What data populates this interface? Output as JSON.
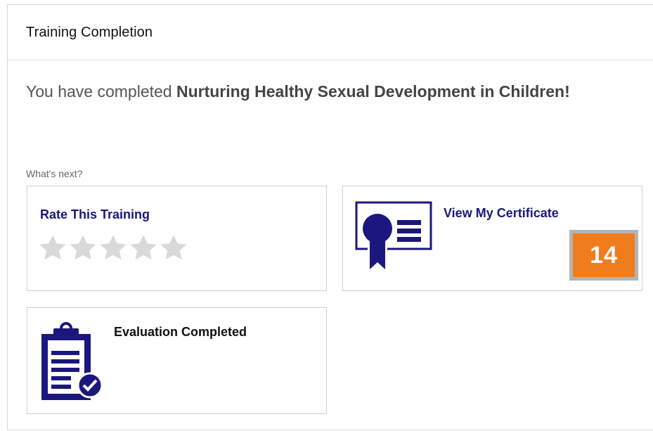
{
  "header": {
    "title": "Training Completion"
  },
  "completion": {
    "prefix": "You have completed ",
    "course_name": "Nurturing Healthy Sexual Development in Children!"
  },
  "next": {
    "label": "What's next?"
  },
  "cards": {
    "rate": {
      "title": "Rate This Training",
      "stars_total": 5,
      "stars_selected": 0
    },
    "certificate": {
      "title": "View My Certificate",
      "icon": "certificate-icon",
      "badge_count": "14"
    },
    "evaluation": {
      "title": "Evaluation Completed",
      "icon": "clipboard-check-icon"
    }
  },
  "colors": {
    "accent": "#1b177e",
    "badge": "#ef7d1e",
    "star_empty": "#d9d9d9"
  }
}
